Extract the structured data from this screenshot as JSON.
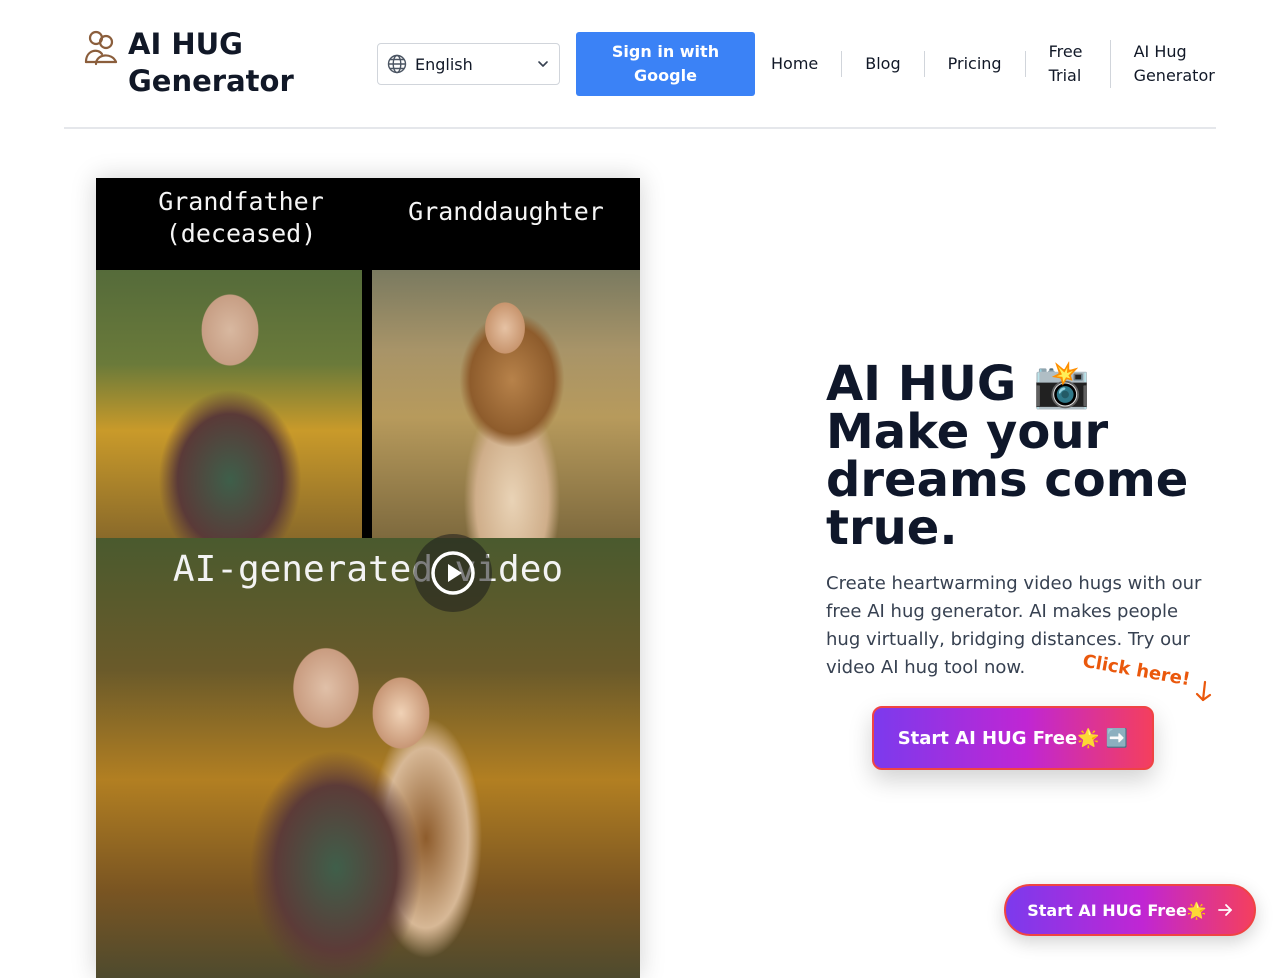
{
  "brand": {
    "name": "AI HUG Generator",
    "icon": "hug-couple-icon"
  },
  "language": {
    "selected": "English",
    "icon": "globe-icon"
  },
  "header": {
    "signin_label": "Sign in with Google",
    "nav": [
      {
        "label": "Home"
      },
      {
        "label": "Blog"
      },
      {
        "label": "Pricing"
      },
      {
        "label": "Free Trial"
      },
      {
        "label": "AI Hug Generator"
      }
    ]
  },
  "video": {
    "caption_left": "Grandfather (deceased)",
    "caption_right": "Granddaughter",
    "caption_bottom": "AI-generated video",
    "play_icon": "play-icon"
  },
  "hero": {
    "title_line1": "AI HUG",
    "title_emoji": "📸",
    "title_rest": "Make your dreams come true.",
    "description": "Create heartwarming video hugs with our free AI hug generator. AI makes people hug virtually, bridging distances. Try our video AI hug tool now.",
    "click_hint": "Click here!",
    "cta_label": "Start AI HUG Free🌟 ➡️"
  },
  "floating_cta": {
    "label": "Start AI HUG Free🌟"
  },
  "colors": {
    "primary_blue": "#3b82f6",
    "cta_start": "#7c3aed",
    "cta_end": "#f43f5e",
    "hint_orange": "#ea580c"
  }
}
